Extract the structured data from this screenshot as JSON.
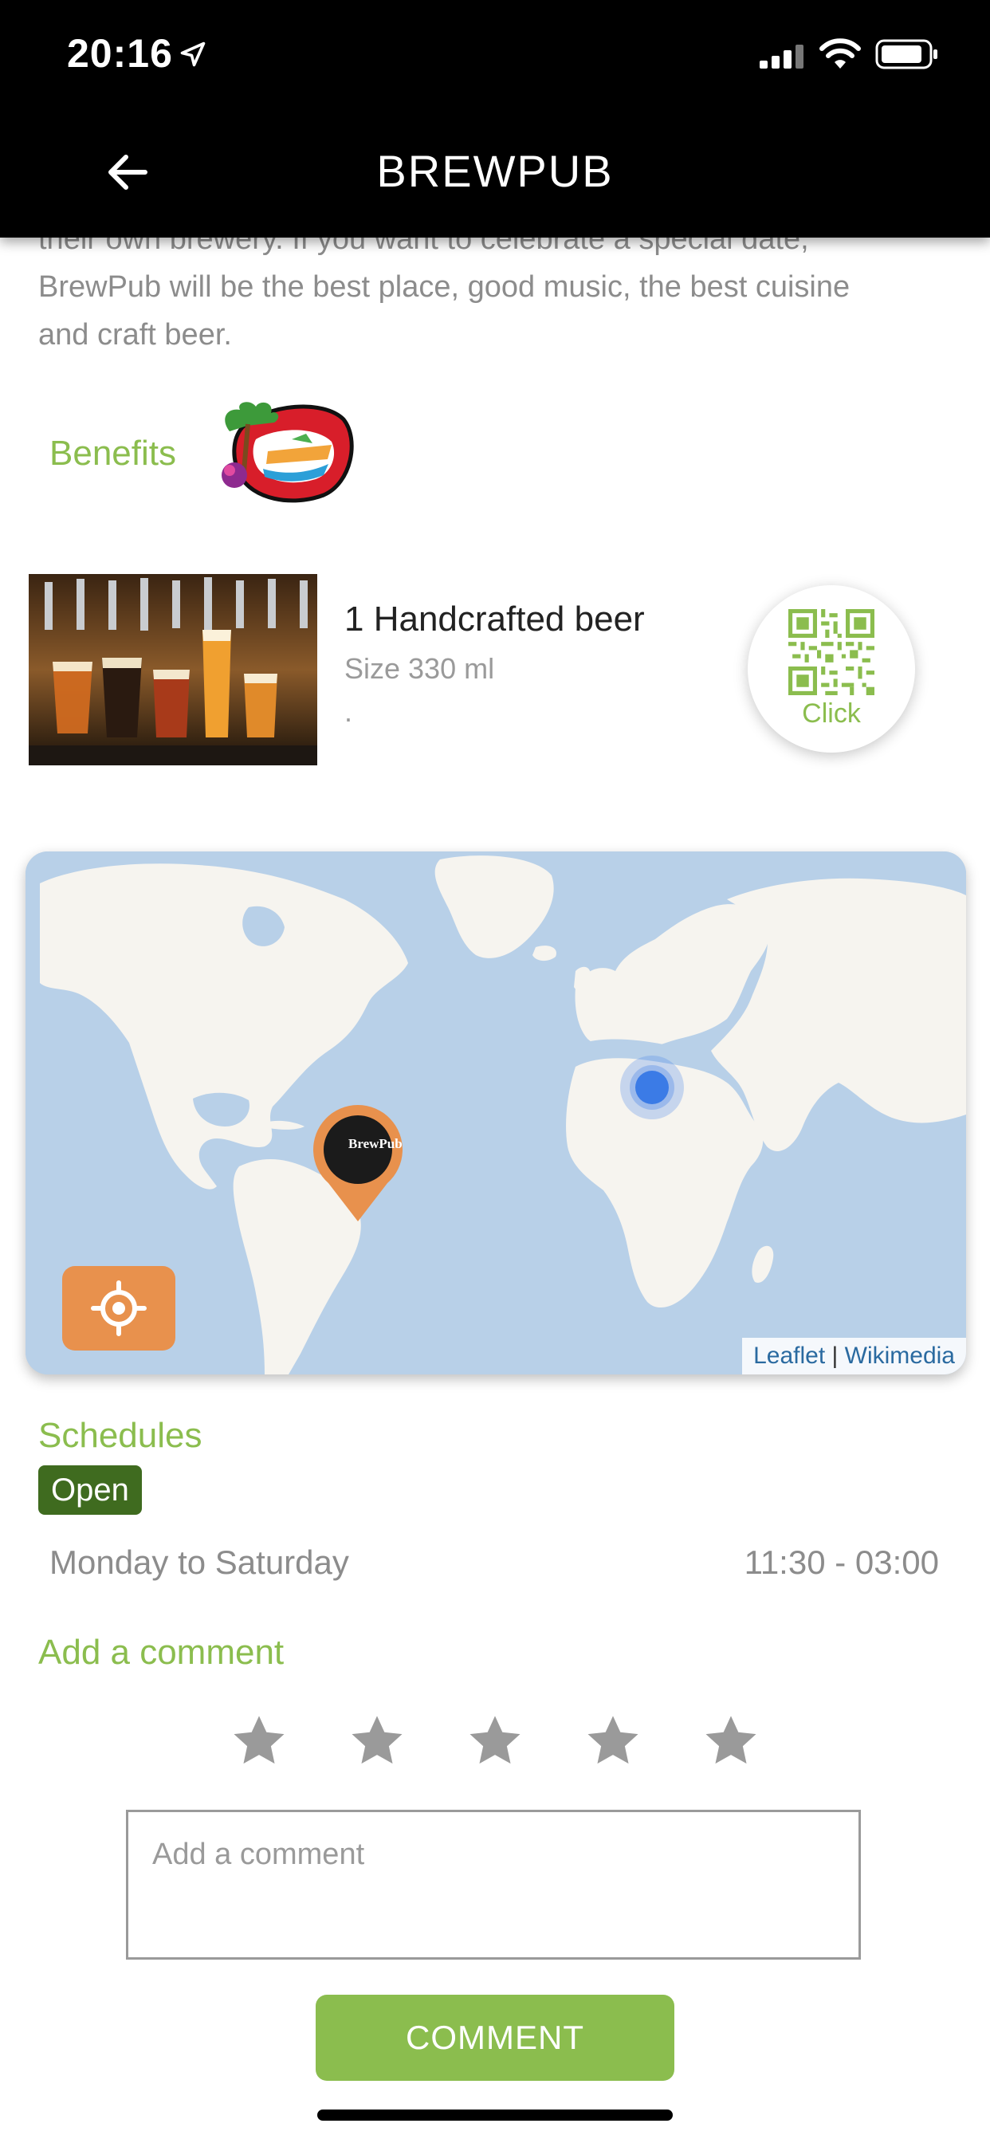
{
  "status_bar": {
    "time": "20:16"
  },
  "header": {
    "title": "BREWPUB"
  },
  "description": {
    "line1": "their own brewery. If you want to celebrate a special date,",
    "line2": "BrewPub will be the best place, good music, the best cuisine",
    "line3": "and craft beer."
  },
  "benefits": {
    "label": "Benefits"
  },
  "offer": {
    "title": "1 Handcrafted beer",
    "size": "Size 330 ml",
    "note": ".",
    "qr_label": "Click"
  },
  "map": {
    "pin_label": "BrewPub",
    "attribution_leaflet": "Leaflet",
    "attribution_sep": "|",
    "attribution_wikimedia": "Wikimedia"
  },
  "schedules": {
    "label": "Schedules",
    "status": "Open",
    "rows": [
      {
        "days": "Monday to Saturday",
        "hours": "11:30 - 03:00"
      }
    ]
  },
  "comment": {
    "label": "Add a comment",
    "rating": 0,
    "max_rating": 5,
    "placeholder": "Add a comment",
    "button": "COMMENT"
  },
  "colors": {
    "accent_green": "#8bbd4e",
    "badge_green": "#3f6b1f",
    "map_orange": "#e8914d",
    "star_gray": "#9a9a9a"
  }
}
